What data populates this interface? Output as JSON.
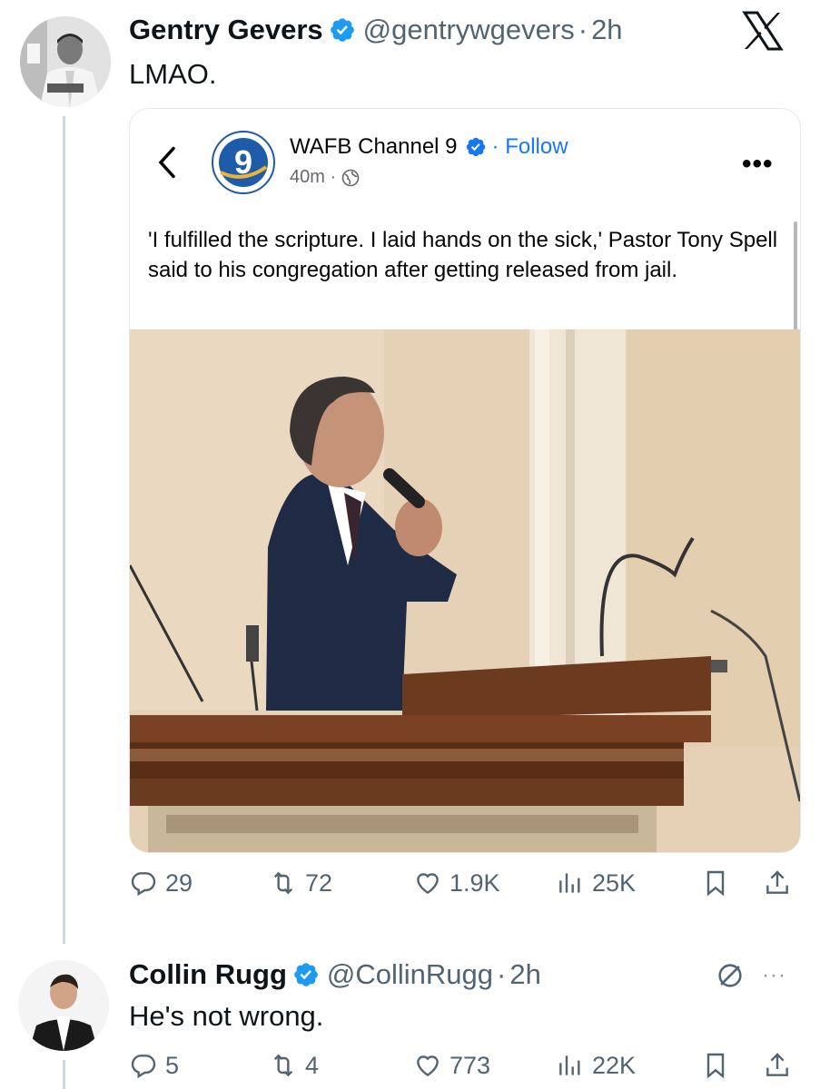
{
  "tweet1": {
    "display_name": "Gentry Gevers",
    "handle": "@gentrywgevers",
    "time": "2h",
    "separator": "·",
    "text": "LMAO.",
    "embedded_post": {
      "page_name": "WAFB Channel 9",
      "follow_label": "· Follow",
      "time": "40m ·",
      "more": "•••",
      "text": "'I fulfilled the scripture. I laid hands on the sick,' Pastor Tony Spell said to his congregation after getting released from jail.",
      "logo_text": "9"
    },
    "stats": {
      "replies": "29",
      "reposts": "72",
      "likes": "1.9K",
      "views": "25K"
    }
  },
  "tweet2": {
    "display_name": "Collin Rugg",
    "handle": "@CollinRugg",
    "time": "2h",
    "separator": "·",
    "text": "He's not wrong.",
    "more": "···",
    "stats": {
      "replies": "5",
      "reposts": "4",
      "likes": "773",
      "views": "22K"
    }
  },
  "colors": {
    "text_primary": "#0f1419",
    "text_secondary": "#536471",
    "verified_blue": "#1d9bf0",
    "facebook_blue": "#1877f2"
  },
  "icons": [
    "x-logo-icon",
    "verified-icon",
    "back-chevron-icon",
    "globe-icon",
    "reply-icon",
    "repost-icon",
    "like-icon",
    "views-icon",
    "bookmark-icon",
    "share-icon",
    "grok-icon"
  ]
}
